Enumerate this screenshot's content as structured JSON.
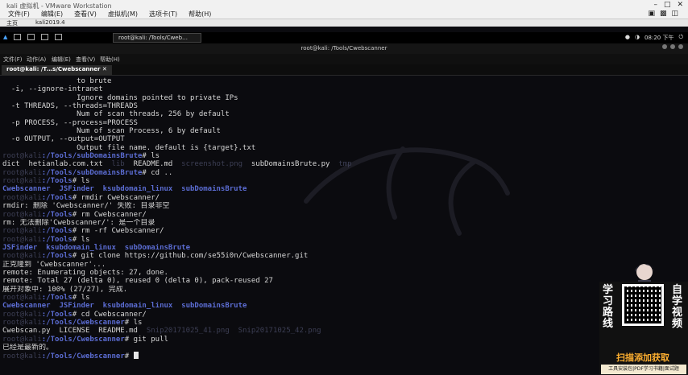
{
  "vm_window": {
    "title": "kali 虚拟机 - VMware Workstation",
    "menu": [
      "文件(F)",
      "编辑(E)",
      "查看(V)",
      "虚拟机(M)",
      "选项卡(T)",
      "帮助(H)"
    ],
    "tabs": [
      "主页",
      "kali2019.4"
    ]
  },
  "kali_panel": {
    "task": "root@kali: /Tools/Cweb…",
    "clock": "08:20 下午"
  },
  "terminal": {
    "window_title": "root@kali: /Tools/Cwebscanner",
    "menu": [
      "文件(F)",
      "动作(A)",
      "编辑(E)",
      "查看(V)",
      "帮助(H)"
    ],
    "tab_label": "root@kali: /T…s/Cwebscanner",
    "prompt_host": "root@kali",
    "lines": [
      {
        "t": "plain",
        "text": "                 to brute"
      },
      {
        "t": "plain",
        "text": "  -i, --ignore-intranet"
      },
      {
        "t": "plain",
        "text": "                 Ignore domains pointed to private IPs"
      },
      {
        "t": "plain",
        "text": "  -t THREADS, --threads=THREADS"
      },
      {
        "t": "plain",
        "text": "                 Num of scan threads, 256 by default"
      },
      {
        "t": "plain",
        "text": "  -p PROCESS, --process=PROCESS"
      },
      {
        "t": "plain",
        "text": "                 Num of scan Process, 6 by default"
      },
      {
        "t": "plain",
        "text": "  -o OUTPUT, --output=OUTPUT"
      },
      {
        "t": "plain",
        "text": "                 Output file name. default is {target}.txt"
      },
      {
        "t": "prompt",
        "path": ":/Tools/subDomainsBrute",
        "cmd": "# ls"
      },
      {
        "t": "mixed",
        "parts": [
          [
            "plain",
            "dict  hetianlab.com.txt  "
          ],
          [
            "dim",
            "lib  "
          ],
          [
            "plain",
            "README.md  "
          ],
          [
            "dim",
            "screenshot.png  "
          ],
          [
            "plain",
            "subDomainsBrute.py  "
          ],
          [
            "dim",
            "tmp"
          ]
        ]
      },
      {
        "t": "prompt",
        "path": ":/Tools/subDomainsBrute",
        "cmd": "# cd .."
      },
      {
        "t": "prompt",
        "path": ":/Tools",
        "cmd": "# ls"
      },
      {
        "t": "mixed",
        "parts": [
          [
            "blue",
            "Cwebscanner  JSFinder  ksubdomain_linux  subDomainsBrute"
          ]
        ]
      },
      {
        "t": "prompt",
        "path": ":/Tools",
        "cmd": "# rmdir Cwebscanner/"
      },
      {
        "t": "plain",
        "text": "rmdir: 删除 'Cwebscanner/' 失败: 目录非空"
      },
      {
        "t": "prompt",
        "path": ":/Tools",
        "cmd": "# rm Cwebscanner/"
      },
      {
        "t": "plain",
        "text": "rm: 无法删除'Cwebscanner/': 是一个目录"
      },
      {
        "t": "prompt",
        "path": ":/Tools",
        "cmd": "# rm -rf Cwebscanner/"
      },
      {
        "t": "prompt",
        "path": ":/Tools",
        "cmd": "# ls"
      },
      {
        "t": "mixed",
        "parts": [
          [
            "blue",
            "JSFinder  ksubdomain_linux  subDomainsBrute"
          ]
        ]
      },
      {
        "t": "prompt",
        "path": ":/Tools",
        "cmd": "# git clone https://github.com/se55i0n/Cwebscanner.git"
      },
      {
        "t": "plain",
        "text": "正克隆到 'Cwebscanner'..."
      },
      {
        "t": "plain",
        "text": "remote: Enumerating objects: 27, done."
      },
      {
        "t": "plain",
        "text": "remote: Total 27 (delta 0), reused 0 (delta 0), pack-reused 27"
      },
      {
        "t": "plain",
        "text": "展开对象中: 100% (27/27), 完成."
      },
      {
        "t": "prompt",
        "path": ":/Tools",
        "cmd": "# ls"
      },
      {
        "t": "mixed",
        "parts": [
          [
            "blue",
            "Cwebscanner  JSFinder  ksubdomain_linux  subDomainsBrute"
          ]
        ]
      },
      {
        "t": "prompt",
        "path": ":/Tools",
        "cmd": "# cd Cwebscanner/"
      },
      {
        "t": "prompt",
        "path": ":/Tools/Cwebscanner",
        "cmd": "# ls"
      },
      {
        "t": "mixed",
        "parts": [
          [
            "plain",
            "Cwebscan.py  LICENSE  README.md  "
          ],
          [
            "dim",
            "Snip20171025_41.png  Snip20171025_42.png"
          ]
        ]
      },
      {
        "t": "prompt",
        "path": ":/Tools/Cwebscanner",
        "cmd": "# git pull"
      },
      {
        "t": "plain",
        "text": "已经是最新的。"
      },
      {
        "t": "prompt",
        "path": ":/Tools/Cwebscanner",
        "cmd": "# ",
        "cursor": true
      }
    ]
  },
  "ad": {
    "left_chars": [
      "学",
      "习",
      "路",
      "线"
    ],
    "right_chars": [
      "自",
      "学",
      "视",
      "频"
    ],
    "scan_text": "扫描添加获取",
    "footer": "工具安装包|PDF学习书籍|面试题"
  }
}
